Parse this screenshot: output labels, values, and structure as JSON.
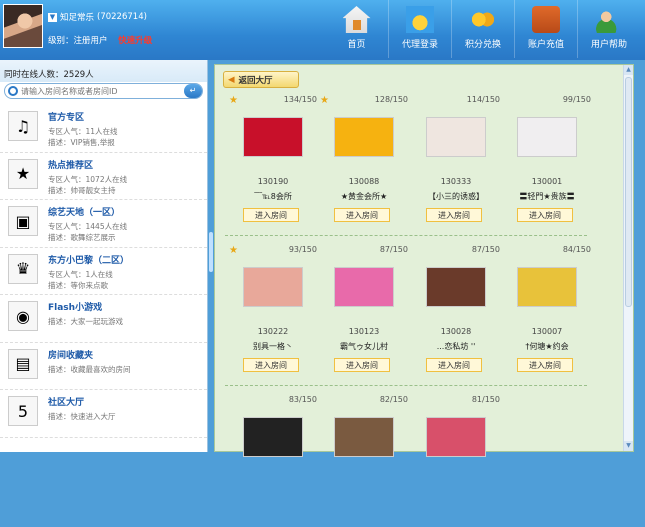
{
  "header": {
    "username": "知足常乐",
    "user_id": "(70226714)",
    "level_label": "级别：注册用户",
    "upgrade_label": "快速升级",
    "nav": [
      {
        "label": "首页",
        "icon": "home-icon"
      },
      {
        "label": "代理登录",
        "icon": "medal-icon"
      },
      {
        "label": "积分兑换",
        "icon": "coins-icon"
      },
      {
        "label": "账户充值",
        "icon": "wallet-icon"
      },
      {
        "label": "用户帮助",
        "icon": "help-user-icon"
      }
    ]
  },
  "sidebar": {
    "online_label": "同时在线人数：2529人",
    "search_placeholder": "请输入房间名称或者房间ID",
    "zones": [
      {
        "title": "官方专区",
        "line1": "专区人气：11人在线",
        "line2": "描述：VIP销售,举报",
        "icon": "gramophone-icon"
      },
      {
        "title": "热点推荐区",
        "line1": "专区人气：1072人在线",
        "line2": "描述：帅哥靓女主持",
        "icon": "star-badge-icon"
      },
      {
        "title": "综艺天地（一区）",
        "line1": "专区人气：1445人在线",
        "line2": "描述：歌舞综艺展示",
        "icon": "camera-icon"
      },
      {
        "title": "东方小巴黎（二区）",
        "line1": "专区人气：1人在线",
        "line2": "描述：等你来点歌",
        "icon": "top-hat-icon"
      },
      {
        "title": "Flash小游戏",
        "line1": "描述：大家一起玩游戏",
        "line2": "",
        "icon": "game-icon"
      },
      {
        "title": "房间收藏夹",
        "line1": "描述：收藏最喜欢的房间",
        "line2": "",
        "icon": "folder-icon"
      },
      {
        "title": "社区大厅",
        "line1": "描述：快速进入大厅",
        "line2": "",
        "icon": "shield-five-icon"
      }
    ]
  },
  "main": {
    "back_label": "返回大厅",
    "enter_label": "进入房间",
    "rooms": [
      {
        "count": "134/150",
        "id": "130190",
        "name": "﹋℡8会所",
        "star": true,
        "thumb_color": "#c8102a"
      },
      {
        "count": "128/150",
        "id": "130088",
        "name": "★黄金会所★",
        "star": true,
        "thumb_color": "#f6b210"
      },
      {
        "count": "114/150",
        "id": "130333",
        "name": "【小三的诱惑】",
        "star": false,
        "thumb_color": "#efe6e0"
      },
      {
        "count": "99/150",
        "id": "130001",
        "name": "〓轻門★贵族〓",
        "star": false,
        "thumb_color": "#f0eef0"
      },
      {
        "count": "93/150",
        "id": "130222",
        "name": "别具一格丶",
        "star": true,
        "thumb_color": "#e8a89a"
      },
      {
        "count": "87/150",
        "id": "130123",
        "name": "霸气ゥ女儿村",
        "star": false,
        "thumb_color": "#e86aaa"
      },
      {
        "count": "87/150",
        "id": "130028",
        "name": "...恋私坊 ''",
        "star": false,
        "thumb_color": "#6a3a2a"
      },
      {
        "count": "84/150",
        "id": "130007",
        "name": "†何塘★约会",
        "star": false,
        "thumb_color": "#e8c23a"
      },
      {
        "count": "83/150",
        "id": "",
        "name": "",
        "star": false,
        "thumb_color": "#222222"
      },
      {
        "count": "82/150",
        "id": "",
        "name": "",
        "star": false,
        "thumb_color": "#7a5a40"
      },
      {
        "count": "81/150",
        "id": "",
        "name": "",
        "star": false,
        "thumb_color": "#d8506a"
      }
    ]
  },
  "colors": {
    "header_blue": "#2f86d3",
    "panel_green": "#e3f0d9",
    "upgrade_red": "#ff3a2a",
    "link_blue": "#1e5aa8"
  }
}
